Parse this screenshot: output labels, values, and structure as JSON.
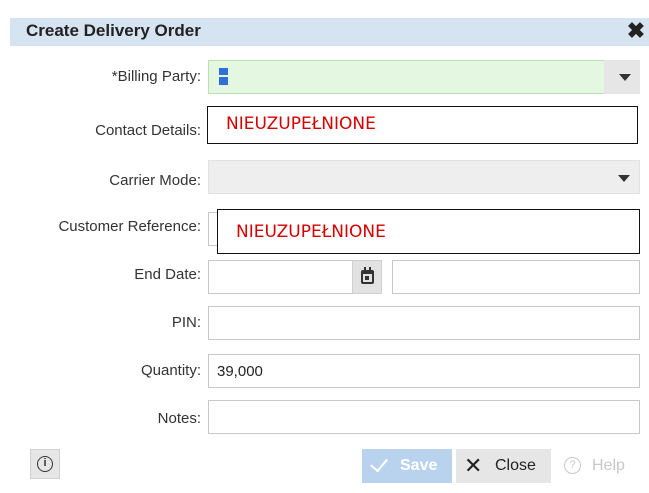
{
  "dialog": {
    "title": "Create Delivery Order",
    "close_icon": "close-icon"
  },
  "fields": {
    "billing_party": {
      "label": "*Billing Party:",
      "value": ""
    },
    "contact_details": {
      "label": "Contact Details:",
      "overlay": "NIEUZUPEŁNIONE"
    },
    "carrier_mode": {
      "label": "Carrier Mode:",
      "value": ""
    },
    "customer_reference": {
      "label": "Customer Reference:",
      "overlay": "NIEUZUPEŁNIONE"
    },
    "end_date": {
      "label": "End Date:",
      "date": "",
      "time": ""
    },
    "pin": {
      "label": "PIN:",
      "value": ""
    },
    "quantity": {
      "label": "Quantity:",
      "value": "39,000"
    },
    "notes": {
      "label": "Notes:",
      "value": ""
    }
  },
  "footer": {
    "info_icon": "info-icon",
    "save_label": "Save",
    "close_label": "Close",
    "help_label": "Help"
  },
  "colors": {
    "titlebar": "#d6e3f0",
    "required_field": "#e4f7e0",
    "overlay_text": "#d40000",
    "save_disabled": "#b9d3ef"
  }
}
